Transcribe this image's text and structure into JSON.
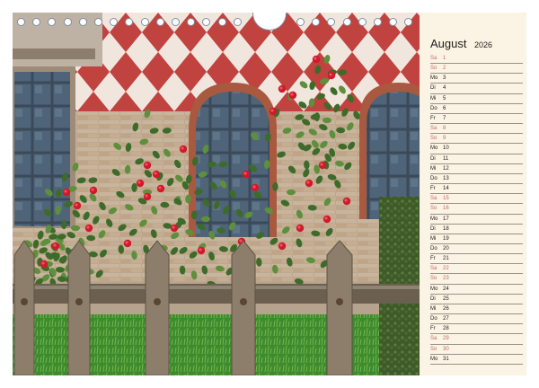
{
  "calendar": {
    "month": "August",
    "year": "2026",
    "days": [
      {
        "wd": "Sa",
        "d": "1",
        "we": true
      },
      {
        "wd": "So",
        "d": "2",
        "we": true
      },
      {
        "wd": "Mo",
        "d": "3",
        "we": false
      },
      {
        "wd": "Di",
        "d": "4",
        "we": false
      },
      {
        "wd": "Mi",
        "d": "5",
        "we": false
      },
      {
        "wd": "Do",
        "d": "6",
        "we": false
      },
      {
        "wd": "Fr",
        "d": "7",
        "we": false
      },
      {
        "wd": "Sa",
        "d": "8",
        "we": true
      },
      {
        "wd": "So",
        "d": "9",
        "we": true
      },
      {
        "wd": "Mo",
        "d": "10",
        "we": false
      },
      {
        "wd": "Di",
        "d": "11",
        "we": false
      },
      {
        "wd": "Mi",
        "d": "12",
        "we": false
      },
      {
        "wd": "Do",
        "d": "13",
        "we": false
      },
      {
        "wd": "Fr",
        "d": "14",
        "we": false
      },
      {
        "wd": "Sa",
        "d": "15",
        "we": true
      },
      {
        "wd": "So",
        "d": "16",
        "we": true
      },
      {
        "wd": "Mo",
        "d": "17",
        "we": false
      },
      {
        "wd": "Di",
        "d": "18",
        "we": false
      },
      {
        "wd": "Mi",
        "d": "19",
        "we": false
      },
      {
        "wd": "Do",
        "d": "20",
        "we": false
      },
      {
        "wd": "Fr",
        "d": "21",
        "we": false
      },
      {
        "wd": "Sa",
        "d": "22",
        "we": true
      },
      {
        "wd": "So",
        "d": "23",
        "we": true
      },
      {
        "wd": "Mo",
        "d": "24",
        "we": false
      },
      {
        "wd": "Di",
        "d": "25",
        "we": false
      },
      {
        "wd": "Mi",
        "d": "26",
        "we": false
      },
      {
        "wd": "Do",
        "d": "27",
        "we": false
      },
      {
        "wd": "Fr",
        "d": "28",
        "we": false
      },
      {
        "wd": "Sa",
        "d": "29",
        "we": true
      },
      {
        "wd": "So",
        "d": "30",
        "we": true
      },
      {
        "wd": "Mo",
        "d": "31",
        "we": false
      }
    ]
  },
  "colors": {
    "panel_background": "#fbf3e3",
    "weekend_text": "#c46a6a",
    "diamond_red": "#c0433f",
    "rose_red": "#d0192b"
  }
}
